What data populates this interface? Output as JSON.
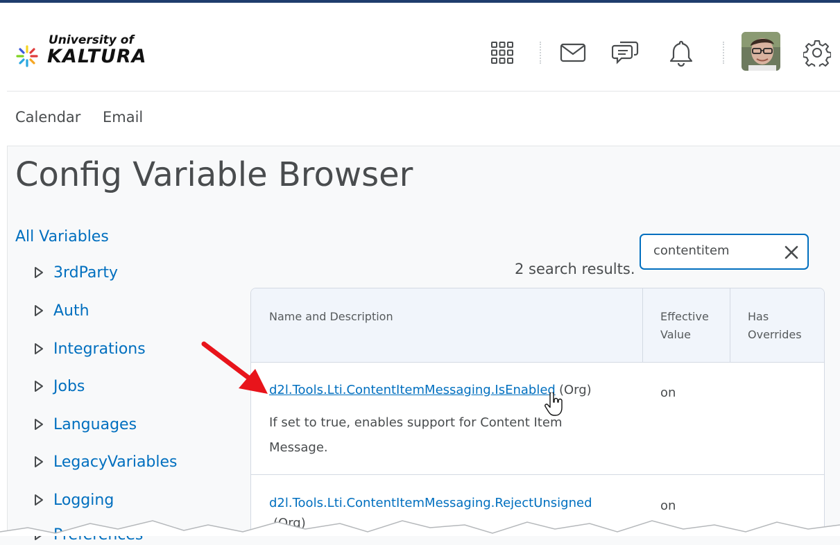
{
  "brand": {
    "line1": "University of",
    "line2": "KALTURA",
    "colors": [
      "#e03b3b",
      "#f5a623",
      "#7ed321",
      "#2aa7e0",
      "#3b5bdb",
      "#f5d423"
    ]
  },
  "header_icons": [
    "waffle-icon",
    "mail-icon",
    "chat-icon",
    "bell-icon",
    "avatar",
    "gear-icon"
  ],
  "nav": {
    "items": [
      "Calendar",
      "Email"
    ]
  },
  "page": {
    "title": "Config Variable Browser"
  },
  "tree": {
    "root_label": "All Variables",
    "items": [
      "3rdParty",
      "Auth",
      "Integrations",
      "Jobs",
      "Languages",
      "LegacyVariables",
      "Logging",
      "Preferences"
    ]
  },
  "search": {
    "value": "contentitem",
    "clear_icon": "close-icon"
  },
  "results": {
    "count_text": "2 search results.",
    "columns": [
      "Name and Description",
      "Effective Value",
      "Has Overrides"
    ],
    "rows": [
      {
        "name": "d2l.Tools.Lti.ContentItemMessaging.IsEnabled",
        "scope": "(Org)",
        "description": "If set to true, enables support for Content Item Message.",
        "effective_value": "on"
      },
      {
        "name": "d2l.Tools.Lti.ContentItemMessaging.RejectUnsigned",
        "scope": "(Org)",
        "description": "",
        "effective_value": "on"
      }
    ]
  },
  "colors": {
    "link": "#006fbf",
    "text": "#494c4e",
    "accent_bar": "#1f3d6d",
    "annotation_arrow": "#e8141b"
  }
}
